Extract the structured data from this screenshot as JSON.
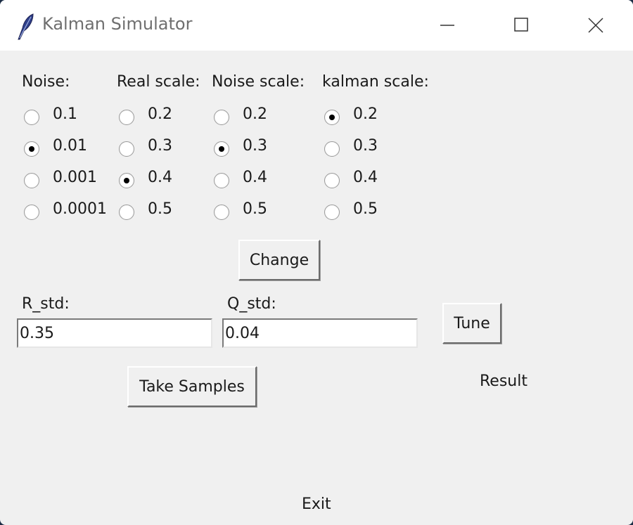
{
  "window": {
    "title": "Kalman Simulator"
  },
  "groups": [
    {
      "label": "Noise:",
      "options": [
        "0.1",
        "0.01",
        "0.001",
        "0.0001"
      ],
      "selected": 1
    },
    {
      "label": "Real scale:",
      "options": [
        "0.2",
        "0.3",
        "0.4",
        "0.5"
      ],
      "selected": 2
    },
    {
      "label": "Noise scale:",
      "options": [
        "0.2",
        "0.3",
        "0.4",
        "0.5"
      ],
      "selected": 1
    },
    {
      "label": "kalman scale:",
      "options": [
        "0.2",
        "0.3",
        "0.4",
        "0.5"
      ],
      "selected": 0
    }
  ],
  "buttons": {
    "change": "Change",
    "tune": "Tune",
    "take_samples": "Take Samples",
    "exit": "Exit"
  },
  "fields": {
    "r_std": {
      "label": "R_std:",
      "value": "0.35"
    },
    "q_std": {
      "label": "Q_std:",
      "value": "0.04"
    }
  },
  "result": {
    "text": "Result"
  }
}
